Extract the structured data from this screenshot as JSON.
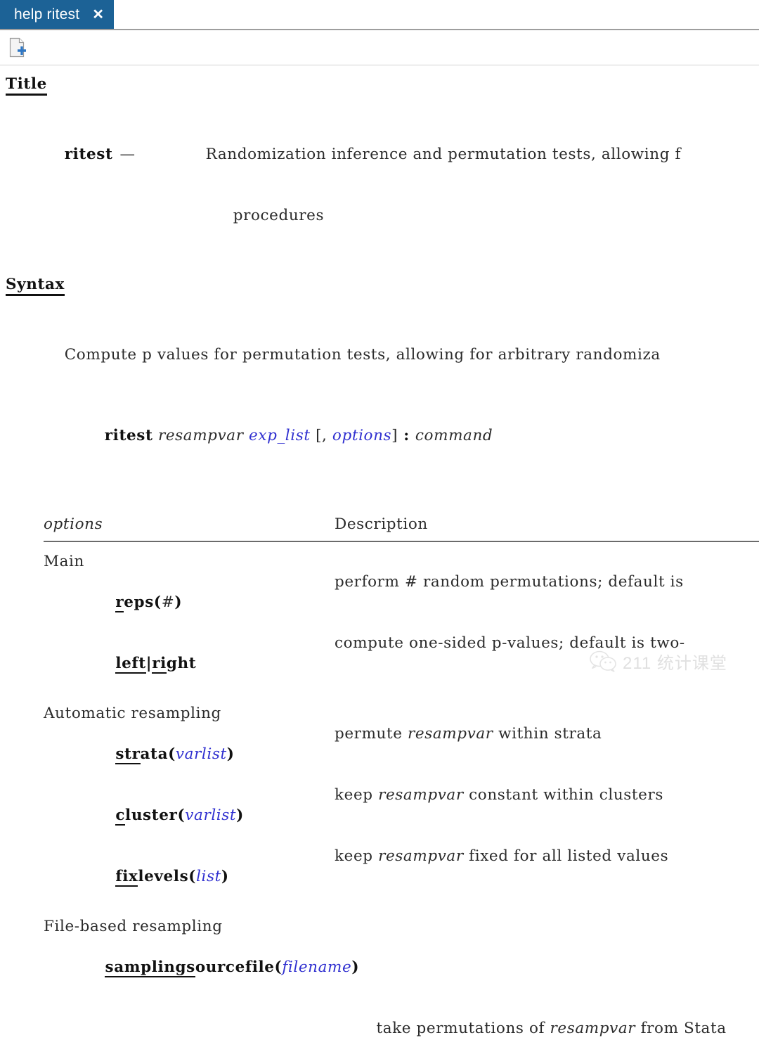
{
  "window": {
    "tab": {
      "label": "help ritest",
      "close_glyph": "✕"
    },
    "toolbar": {
      "new_icon": "new-document-icon"
    }
  },
  "doc": {
    "title_section": {
      "heading": "Title",
      "command": "ritest",
      "dash": "—",
      "description_line1": "Randomization inference and permutation tests, allowing f",
      "description_line2": "procedures"
    },
    "syntax_section": {
      "heading": "Syntax",
      "intro": "Compute p values for permutation tests, allowing for arbitrary randomiza",
      "cmd": {
        "command": "ritest",
        "resampvar": "resampvar",
        "exp_list": "exp_list",
        "open_bracket": "[, ",
        "options": "options",
        "close_bracket": "]",
        "colon": " : ",
        "command_arg": "command"
      }
    },
    "options_table": {
      "header_options": "options",
      "header_description": "Description",
      "groups": [
        {
          "name": "Main",
          "rows": [
            {
              "opt_abbrev": "r",
              "opt_rest": "eps",
              "opt_arg_open": "(",
              "opt_arg": "#",
              "opt_arg_close": ")",
              "opt_arg_is_link": false,
              "desc": "perform # random permutations; default is "
            },
            {
              "opt_abbrev": "left",
              "opt_rest": "",
              "opt_mid": "|",
              "opt_abbrev2": "ri",
              "opt_rest2": "ght",
              "desc": "compute one-sided p-values; default is two-"
            }
          ]
        },
        {
          "name": "Automatic resampling",
          "rows": [
            {
              "opt_abbrev": "str",
              "opt_rest": "ata",
              "opt_arg_open": "(",
              "opt_arg": "varlist",
              "opt_arg_close": ")",
              "opt_arg_is_link": true,
              "desc_pre": "permute ",
              "desc_em": "resampvar",
              "desc_post": " within strata"
            },
            {
              "opt_abbrev": "c",
              "opt_rest": "luster",
              "opt_arg_open": "(",
              "opt_arg": "varlist",
              "opt_arg_close": ")",
              "opt_arg_is_link": true,
              "desc_pre": "keep ",
              "desc_em": "resampvar",
              "desc_post": " constant within clusters"
            },
            {
              "opt_abbrev": "fix",
              "opt_rest": "levels",
              "opt_arg_open": "(",
              "opt_arg": "list",
              "opt_arg_close": ")",
              "opt_arg_is_link": true,
              "desc_pre": "keep ",
              "desc_em": "resampvar",
              "desc_post": " fixed for all listed values"
            }
          ]
        },
        {
          "name": "File-based resampling",
          "rows": [
            {
              "opt_abbrev": "samplings",
              "opt_rest": "ourcefile",
              "opt_arg_open": "(",
              "opt_arg": "filename",
              "opt_arg_close": ")",
              "opt_arg_is_link": true,
              "desc_pre": "take permutations of ",
              "desc_em": "resampvar",
              "desc_post": " from Stata"
            }
          ]
        }
      ]
    }
  },
  "watermark": {
    "text": "211 统计课堂",
    "icon": "wechat-icon"
  }
}
